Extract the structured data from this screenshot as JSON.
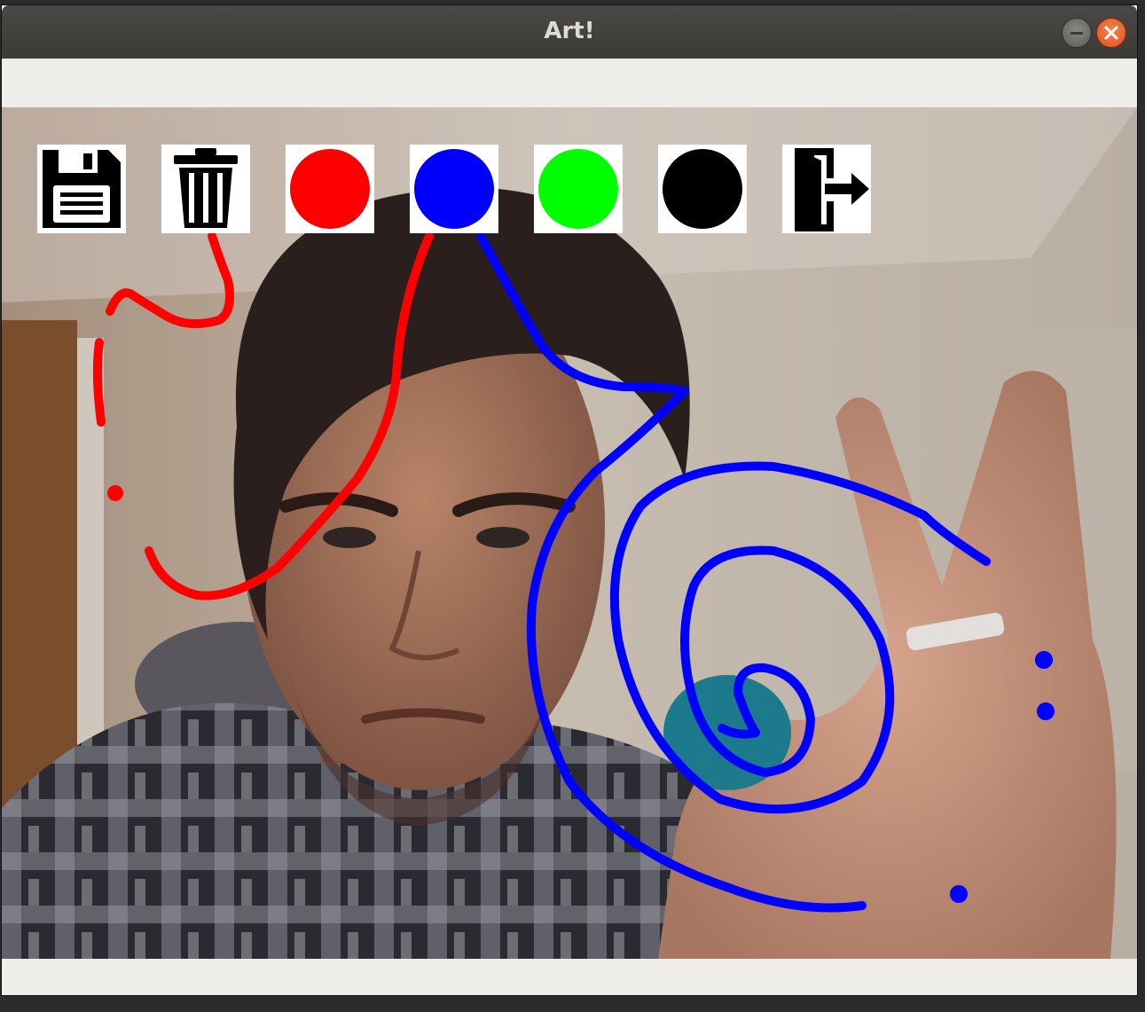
{
  "window": {
    "title": "Art!"
  },
  "toolbar": {
    "tools": [
      {
        "name": "save-icon"
      },
      {
        "name": "trash-icon"
      },
      {
        "name": "color-red",
        "color": "#ff0000"
      },
      {
        "name": "color-blue",
        "color": "#0000ff"
      },
      {
        "name": "color-green",
        "color": "#00ff00"
      },
      {
        "name": "color-black",
        "color": "#000000"
      },
      {
        "name": "exit-icon"
      }
    ]
  },
  "colors": {
    "red_stroke": "#ff0000",
    "blue_stroke": "#0000ff",
    "marker_dot": "#1c7a8c"
  }
}
